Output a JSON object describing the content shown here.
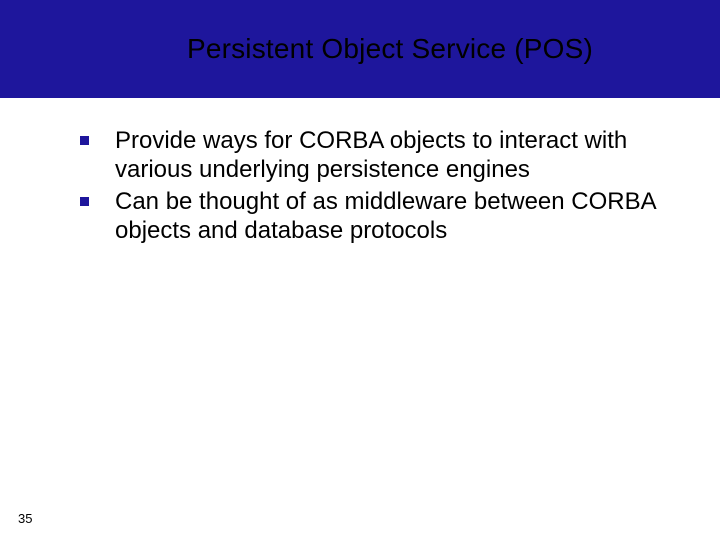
{
  "title": "Persistent Object Service (POS)",
  "bullets": [
    "Provide ways for CORBA objects to interact with various underlying persistence engines",
    "Can be thought of as middleware between CORBA objects and database protocols"
  ],
  "slide_number": "35"
}
